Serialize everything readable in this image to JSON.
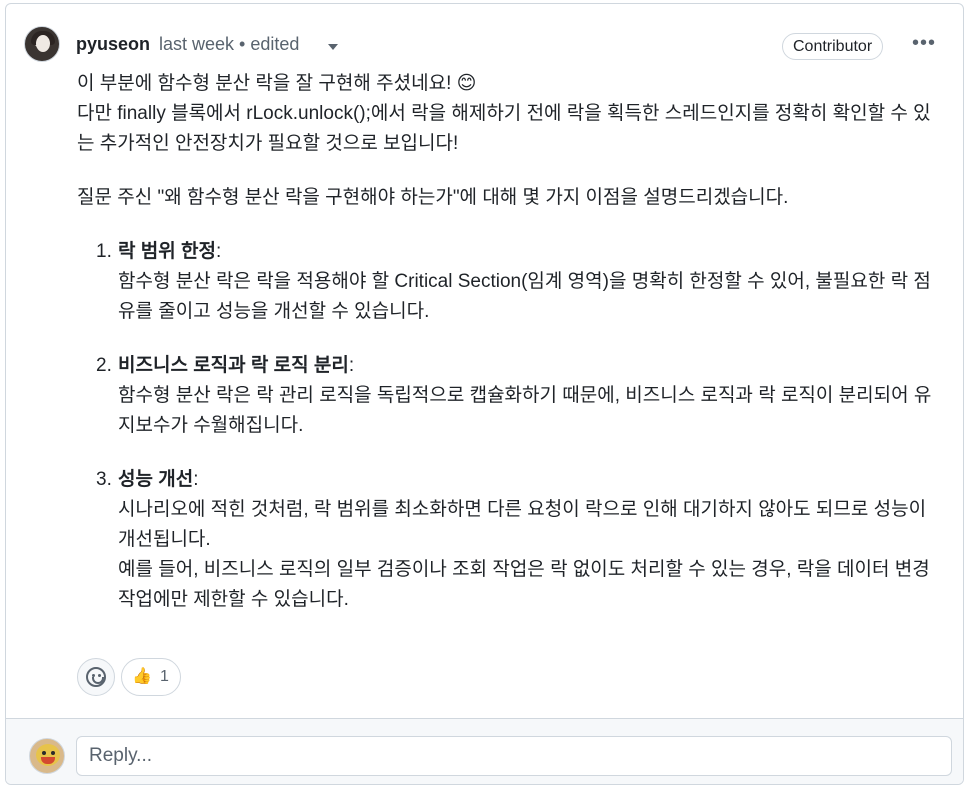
{
  "comment": {
    "author": "pyuseon",
    "meta": "last week • edited",
    "badge": "Contributor",
    "more": "•••",
    "paragraphs": [
      "이 부분에 함수형 분산 락을 잘 구현해 주셨네요! 😊",
      "다만 finally 블록에서 rLock.unlock();에서 락을 해제하기 전에 락을 획득한 스레드인지를 정확히 확인할 수 있는 추가적인 안전장치가 필요할 것으로 보입니다!",
      "질문 주신 \"왜 함수형 분산 락을 구현해야 하는가\"에 대해 몇 가지 이점을 설명드리겠습니다."
    ],
    "items": [
      {
        "num": "1.",
        "title": "락 범위 한정",
        "lines": [
          "함수형 분산 락은 락을 적용해야 할 Critical Section(임계 영역)을 명확히 한정할 수 있어, 불필요한 락 점유를 줄이고 성능을 개선할 수 있습니다."
        ]
      },
      {
        "num": "2.",
        "title": "비즈니스 로직과 락 로직 분리",
        "lines": [
          "함수형 분산 락은 락 관리 로직을 독립적으로 캡슐화하기 때문에, 비즈니스 로직과 락 로직이 분리되어 유지보수가 수월해집니다."
        ]
      },
      {
        "num": "3.",
        "title": "성능 개선",
        "lines": [
          "시나리오에 적힌 것처럼, 락 범위를 최소화하면 다른 요청이 락으로 인해 대기하지 않아도 되므로 성능이 개선됩니다.",
          "예를 들어, 비즈니스 로직의 일부 검증이나 조회 작업은 락 없이도 처리할 수 있는 경우, 락을 데이터 변경 작업에만 제한할 수 있습니다."
        ]
      }
    ]
  },
  "reactions": {
    "thumbs_up_emoji": "👍",
    "thumbs_up_count": "1"
  },
  "reply": {
    "placeholder": "Reply..."
  }
}
